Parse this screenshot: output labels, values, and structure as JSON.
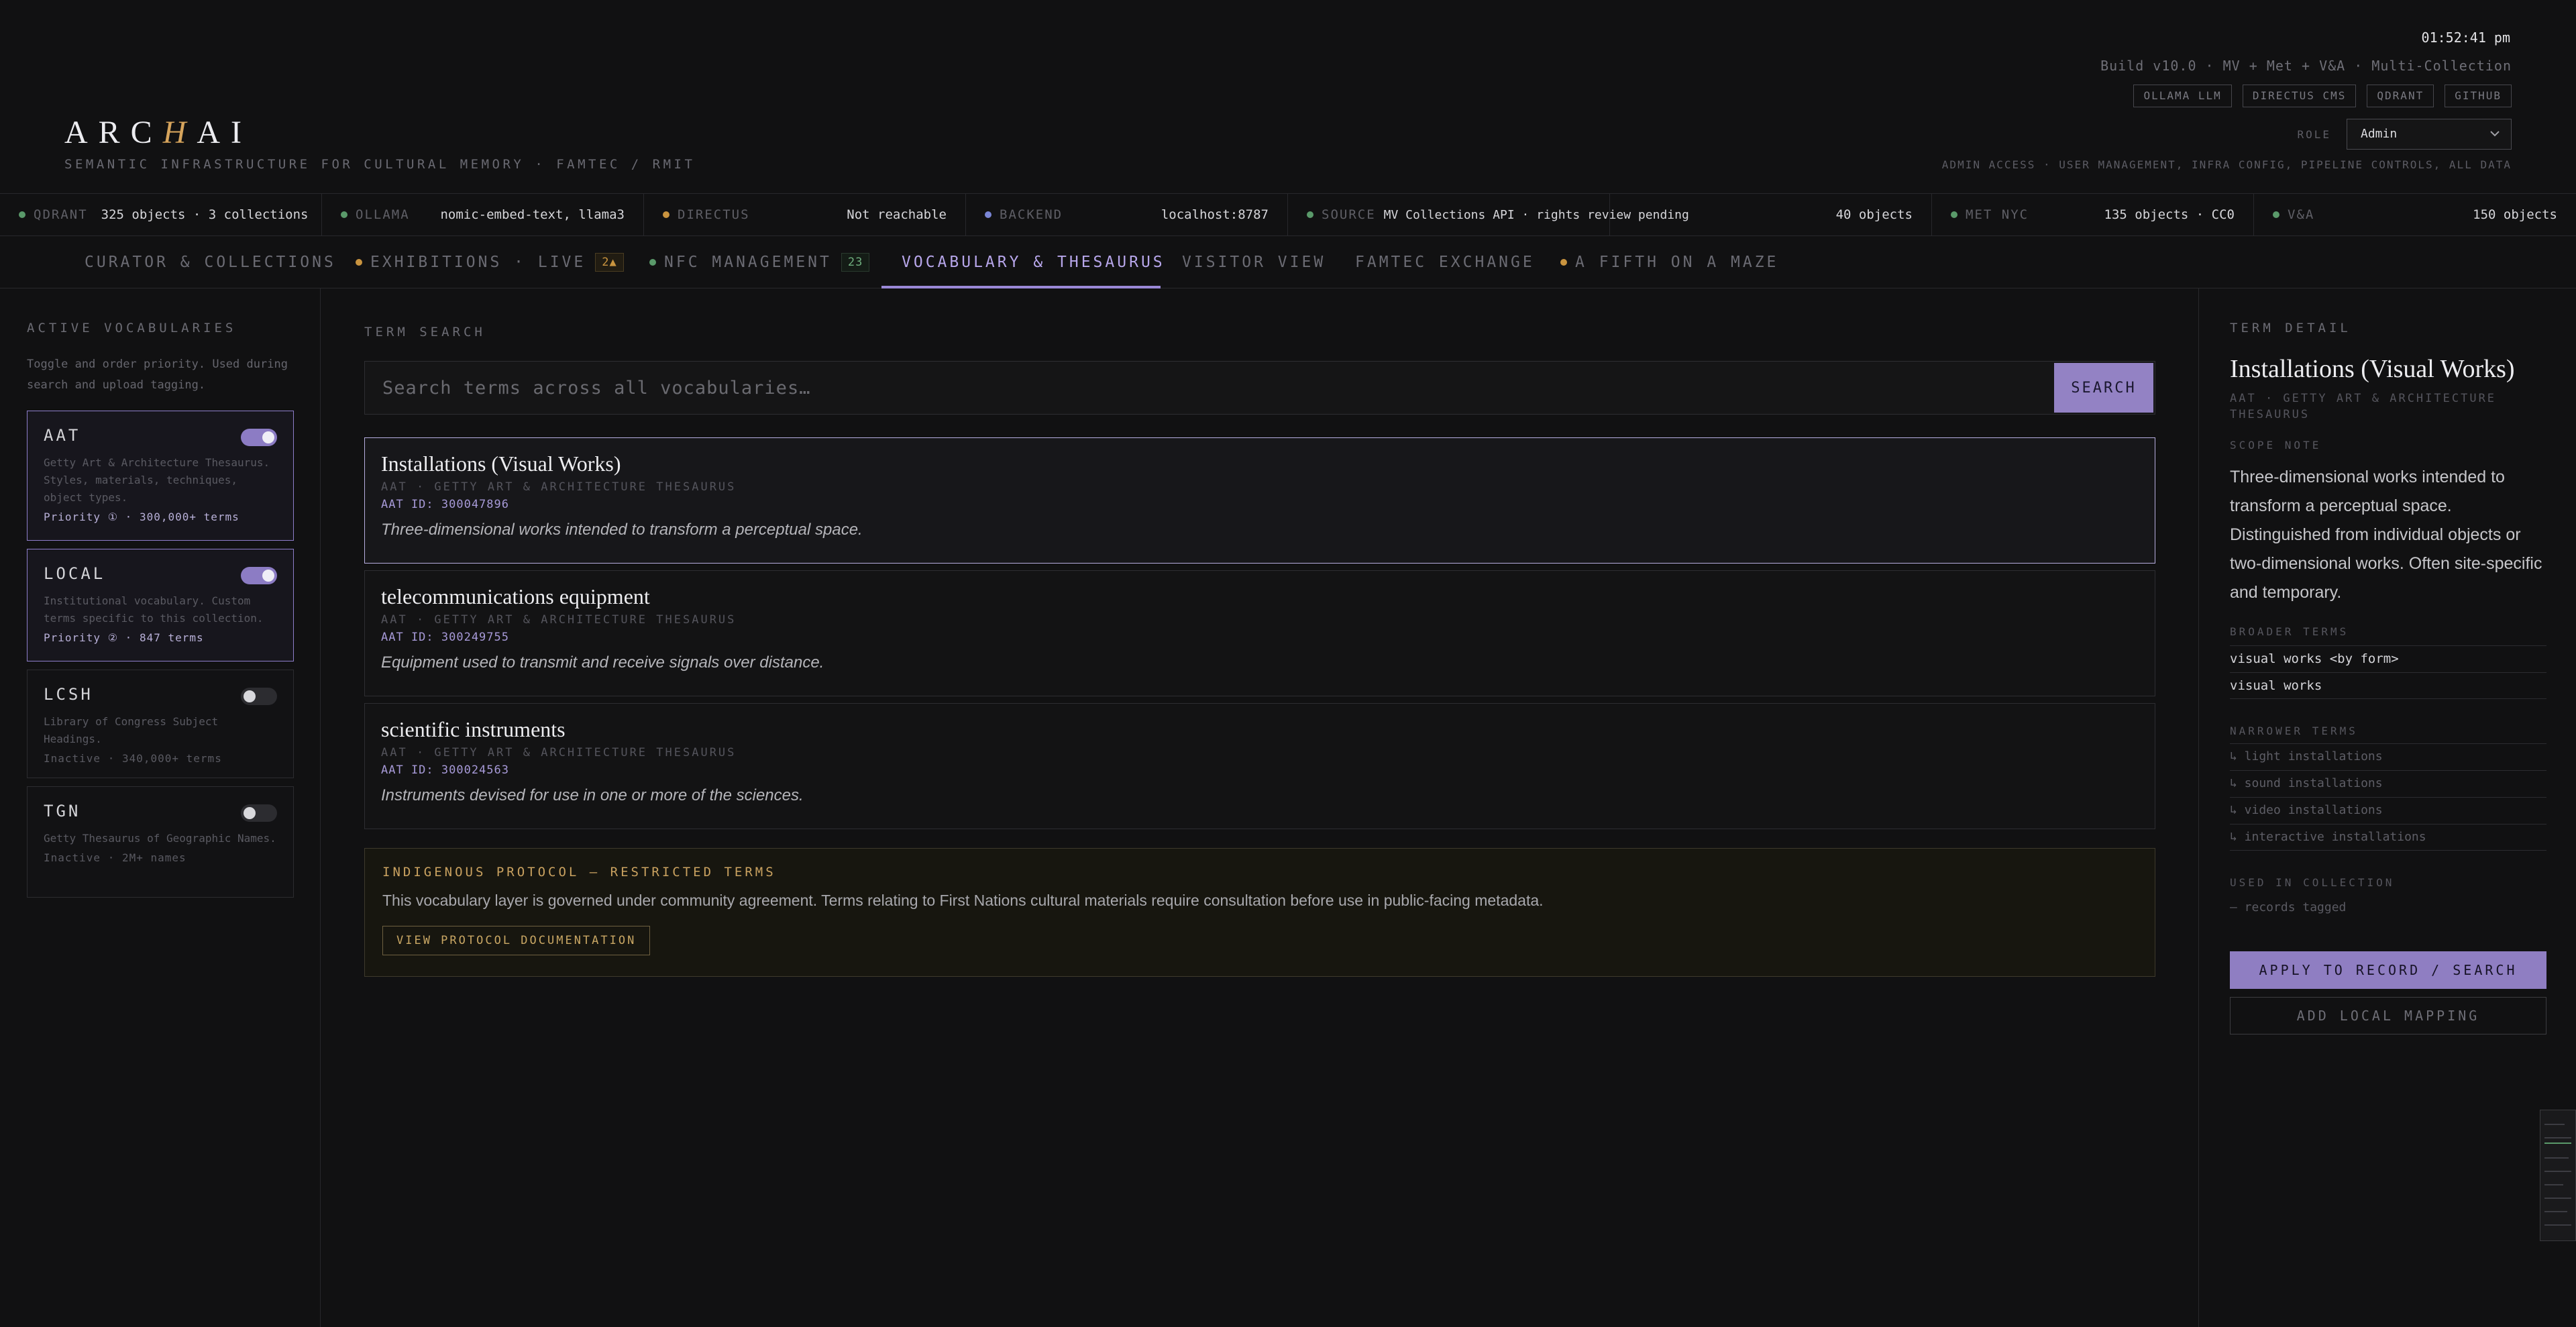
{
  "header": {
    "logo_parts": [
      "ARC",
      "H",
      "AI"
    ],
    "tagline": "SEMANTIC INFRASTRUCTURE FOR CULTURAL MEMORY · FAMTEC / RMIT",
    "clock": "01:52:41 pm",
    "build": "Build v10.0 · MV + Met + V&A · Multi-Collection",
    "links": [
      "OLLAMA LLM",
      "DIRECTUS CMS",
      "QDRANT",
      "GITHUB"
    ],
    "role_label": "ROLE",
    "role_value": "Admin",
    "admin_note": "ADMIN ACCESS · USER MANAGEMENT, INFRA CONFIG, PIPELINE CONTROLS, ALL DATA"
  },
  "status": [
    {
      "name": "QDRANT",
      "value": "325 objects · 3 collections",
      "color": "#5a9a6a"
    },
    {
      "name": "OLLAMA",
      "value": "nomic-embed-text, llama3",
      "color": "#5a9a6a"
    },
    {
      "name": "DIRECTUS",
      "value": "Not reachable",
      "color": "#c9943f"
    },
    {
      "name": "BACKEND",
      "value": "localhost:8787",
      "color": "#7a86d6"
    },
    {
      "name": "SOURCE",
      "value": "MV Collections API · rights review pending",
      "value2": "40 objects",
      "color": "#5a9a6a"
    },
    {
      "name": "MET NYC",
      "value": "135 objects · CC0",
      "color": "#5a9a6a"
    },
    {
      "name": "V&A",
      "value": "150 objects",
      "color": "#5a9a6a"
    }
  ],
  "tabs": [
    {
      "label": "CURATOR & COLLECTIONS"
    },
    {
      "label": "EXHIBITIONS · LIVE",
      "badge": "2▲",
      "dot": "#c9943f"
    },
    {
      "label": "NFC MANAGEMENT",
      "badge": "23",
      "dot": "#5a9a6a"
    },
    {
      "label": "VOCABULARY & THESAURUS"
    },
    {
      "label": "VISITOR VIEW"
    },
    {
      "label": "FAMTEC EXCHANGE"
    },
    {
      "label": "A FIFTH ON A MAZE",
      "dot": "#c9943f"
    }
  ],
  "left": {
    "title": "ACTIVE VOCABULARIES",
    "help": "Toggle and order priority. Used during search and upload tagging.",
    "vocabs": [
      {
        "name": "AAT",
        "desc": "Getty Art & Architecture Thesaurus. Styles, materials, techniques, object types.",
        "meta": "Priority ① · 300,000+ terms",
        "enabled": true
      },
      {
        "name": "LOCAL",
        "desc": "Institutional vocabulary. Custom terms specific to this collection.",
        "meta": "Priority ② · 847 terms",
        "enabled": true
      },
      {
        "name": "LCSH",
        "desc": "Library of Congress Subject Headings.",
        "meta": "Inactive · 340,000+ terms",
        "enabled": false
      },
      {
        "name": "TGN",
        "desc": "Getty Thesaurus of Geographic Names.",
        "meta": "Inactive · 2M+ names",
        "enabled": false
      }
    ]
  },
  "main": {
    "title": "TERM SEARCH",
    "search_placeholder": "Search terms across all vocabularies…",
    "search_button": "SEARCH",
    "results": [
      {
        "title": "Installations (Visual Works)",
        "source": "AAT · GETTY ART & ARCHITECTURE THESAURUS",
        "id": "AAT ID: 300047896",
        "desc": "Three-dimensional works intended to transform a perceptual space."
      },
      {
        "title": "telecommunications equipment",
        "source": "AAT · GETTY ART & ARCHITECTURE THESAURUS",
        "id": "AAT ID: 300249755",
        "desc": "Equipment used to transmit and receive signals over distance."
      },
      {
        "title": "scientific instruments",
        "source": "AAT · GETTY ART & ARCHITECTURE THESAURUS",
        "id": "AAT ID: 300024563",
        "desc": "Instruments devised for use in one or more of the sciences."
      }
    ],
    "protocol": {
      "title": "INDIGENOUS PROTOCOL — RESTRICTED TERMS",
      "text": "This vocabulary layer is governed under community agreement. Terms relating to First Nations cultural materials require consultation before use in public-facing metadata.",
      "button": "VIEW PROTOCOL DOCUMENTATION"
    }
  },
  "detail": {
    "title": "TERM DETAIL",
    "term": "Installations (Visual Works)",
    "source": "AAT · GETTY ART & ARCHITECTURE THESAURUS",
    "scope_label": "SCOPE NOTE",
    "scope": "Three-dimensional works intended to transform a perceptual space. Distinguished from individual objects or two-dimensional works. Often site-specific and temporary.",
    "broader_label": "BROADER TERMS",
    "broader": [
      "visual works <by form>",
      "visual works"
    ],
    "narrower_label": "NARROWER TERMS",
    "narrower": [
      "↳ light installations",
      "↳ sound installations",
      "↳ video installations",
      "↳ interactive installations"
    ],
    "used_label": "USED IN COLLECTION",
    "used": "— records tagged",
    "apply_button": "APPLY TO RECORD / SEARCH",
    "mapping_button": "ADD LOCAL MAPPING"
  }
}
